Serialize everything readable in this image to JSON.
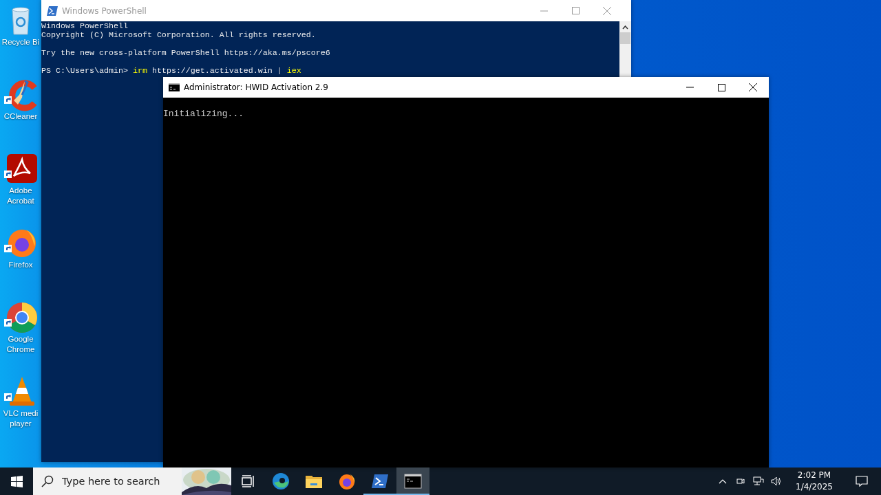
{
  "desktop_icons": [
    {
      "label": "Recycle Bi",
      "kind": "recycle"
    },
    {
      "label": "CCleaner",
      "kind": "ccleaner"
    },
    {
      "label": "Adobe Acrobat",
      "kind": "acrobat"
    },
    {
      "label": "Firefox",
      "kind": "firefox"
    },
    {
      "label": "Google Chrome",
      "kind": "chrome"
    },
    {
      "label": "VLC medi player",
      "kind": "vlc"
    }
  ],
  "powershell_window": {
    "title": "Windows PowerShell",
    "active": false,
    "lines": [
      {
        "kind": "text",
        "text": "Windows PowerShell"
      },
      {
        "kind": "text",
        "text": "Copyright (C) Microsoft Corporation. All rights reserved."
      },
      {
        "kind": "blank"
      },
      {
        "kind": "text",
        "text": "Try the new cross-platform PowerShell https://aka.ms/pscore6"
      },
      {
        "kind": "blank"
      },
      {
        "kind": "prompt",
        "prompt": "PS C:\\Users\\admin>",
        "tokens": [
          {
            "text": "irm",
            "kind": "command"
          },
          {
            "text": "https://get.activated.win",
            "kind": "argument"
          },
          {
            "text": "|",
            "kind": "operator"
          },
          {
            "text": "iex",
            "kind": "command"
          }
        ]
      }
    ]
  },
  "cmd_window": {
    "title": "Administrator:  HWID Activation 2.9",
    "active": true,
    "lines": [
      "Initializing..."
    ]
  },
  "taskbar": {
    "search": {
      "placeholder": "Type here to search"
    },
    "apps": [
      {
        "kind": "taskview",
        "running": false,
        "selected": false
      },
      {
        "kind": "edge",
        "running": false,
        "selected": false
      },
      {
        "kind": "explorer",
        "running": false,
        "selected": false
      },
      {
        "kind": "firefox",
        "running": false,
        "selected": false
      },
      {
        "kind": "powershell",
        "running": true,
        "selected": false
      },
      {
        "kind": "cmd",
        "running": true,
        "selected": true
      }
    ],
    "time": "2:02 PM",
    "date": "1/4/2025"
  }
}
